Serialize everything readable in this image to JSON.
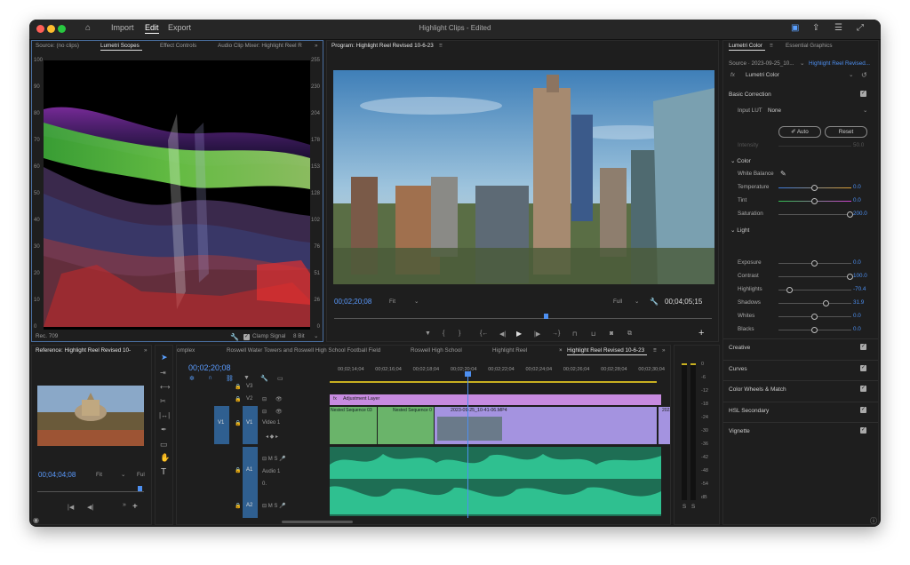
{
  "titlebar": {
    "nav": [
      "Import",
      "Edit",
      "Export"
    ],
    "title": "Highlight Clips - Edited"
  },
  "scopes": {
    "tabs": [
      "Source: (no clips)",
      "Lumetri Scopes",
      "Effect Controls",
      "Audio Clip Mixer: Highlight Reel R"
    ],
    "left_ticks": [
      "100",
      "90",
      "80",
      "70",
      "60",
      "50",
      "40",
      "30",
      "20",
      "10",
      "0"
    ],
    "right_ticks": [
      "255",
      "230",
      "204",
      "178",
      "153",
      "128",
      "102",
      "76",
      "51",
      "26",
      "0"
    ],
    "footer_left": "Rec. 709",
    "clamp_label": "Clamp Signal",
    "bit_depth": "8 Bit"
  },
  "program": {
    "tab": "Program: Highlight Reel Revised 10-6-23",
    "timecode_in": "00;02;20;08",
    "fit": "Fit",
    "quality": "Full",
    "timecode_out": "00;04;05;15",
    "playhead": 0.56
  },
  "reference": {
    "tab": "Reference: Highlight Reel Revised 10-",
    "timecode": "00;04;04;08",
    "fit": "Fit",
    "quality": "Ful"
  },
  "timeline": {
    "tabs": [
      "omplex",
      "Roswell Water Towers and Roswell High School Football Field",
      "Roswell High School",
      "Highlight Reel",
      "Highlight Reel Revised 10-6-23"
    ],
    "timecode": "00;02;20;08",
    "ruler": [
      "00;02;14;04",
      "00;02;16;04",
      "00;02;18;04",
      "00;02;20;04",
      "00;02;22;04",
      "00;02;24;04",
      "00;02;26;04",
      "00;02;28;04",
      "00;02;30;04"
    ],
    "tracks": {
      "v3": "V3",
      "v2": "V2",
      "v1": "V1",
      "v1_source": "V1",
      "v1_name": "Video 1",
      "a1": "A1",
      "a1_source": "A1",
      "a1_name": "Audio 1",
      "a2": "A2",
      "a2_source": "A2",
      "pan": "0."
    },
    "clips": {
      "adjustment": "Adjustment Layer",
      "nested1": "Nested Sequence 03",
      "nested2": "Nested Sequence 0",
      "mp4": "2023-09-25_10-41-06.MP4",
      "right": "2023"
    }
  },
  "meter": {
    "ticks": [
      "0",
      "-6",
      "-12",
      "-18",
      "-24",
      "-30",
      "-36",
      "-42",
      "-48",
      "-54",
      "dB"
    ],
    "solo": [
      "S",
      "S"
    ]
  },
  "lumetri": {
    "tabs": [
      "Lumetri Color",
      "Essential Graphics"
    ],
    "source_label": "Source · 2023-09-25_10...",
    "target_label": "Highlight Reel Revised...",
    "fx": "fx",
    "effect_name": "Lumetri Color",
    "basic_correction": "Basic Correction",
    "input_lut_label": "Input LUT",
    "input_lut_value": "None",
    "auto": "Auto",
    "reset": "Reset",
    "intensity_label": "Intensity",
    "intensity_value": "50.0",
    "color_section": "Color",
    "white_balance": "White Balance",
    "light_section": "Light",
    "color_params": [
      {
        "label": "Temperature",
        "value": "0.0",
        "pos": 0.5
      },
      {
        "label": "Tint",
        "value": "0.0",
        "pos": 0.5
      },
      {
        "label": "Saturation",
        "value": "200.0",
        "pos": 1.0
      }
    ],
    "light_params": [
      {
        "label": "Exposure",
        "value": "0.0",
        "pos": 0.5
      },
      {
        "label": "Contrast",
        "value": "100.0",
        "pos": 1.0
      },
      {
        "label": "Highlights",
        "value": "-70.4",
        "pos": 0.15
      },
      {
        "label": "Shadows",
        "value": "31.9",
        "pos": 0.66
      },
      {
        "label": "Whites",
        "value": "0.0",
        "pos": 0.5
      },
      {
        "label": "Blacks",
        "value": "0.0",
        "pos": 0.5
      }
    ],
    "sections": [
      "Creative",
      "Curves",
      "Color Wheels & Match",
      "HSL Secondary",
      "Vignette"
    ]
  },
  "colors": {
    "accent": "#4d8ff0",
    "adjustment": "#c78be0",
    "nested": "#6ab46a",
    "clip_purple": "#a493e0",
    "audio": "#2fa886"
  }
}
